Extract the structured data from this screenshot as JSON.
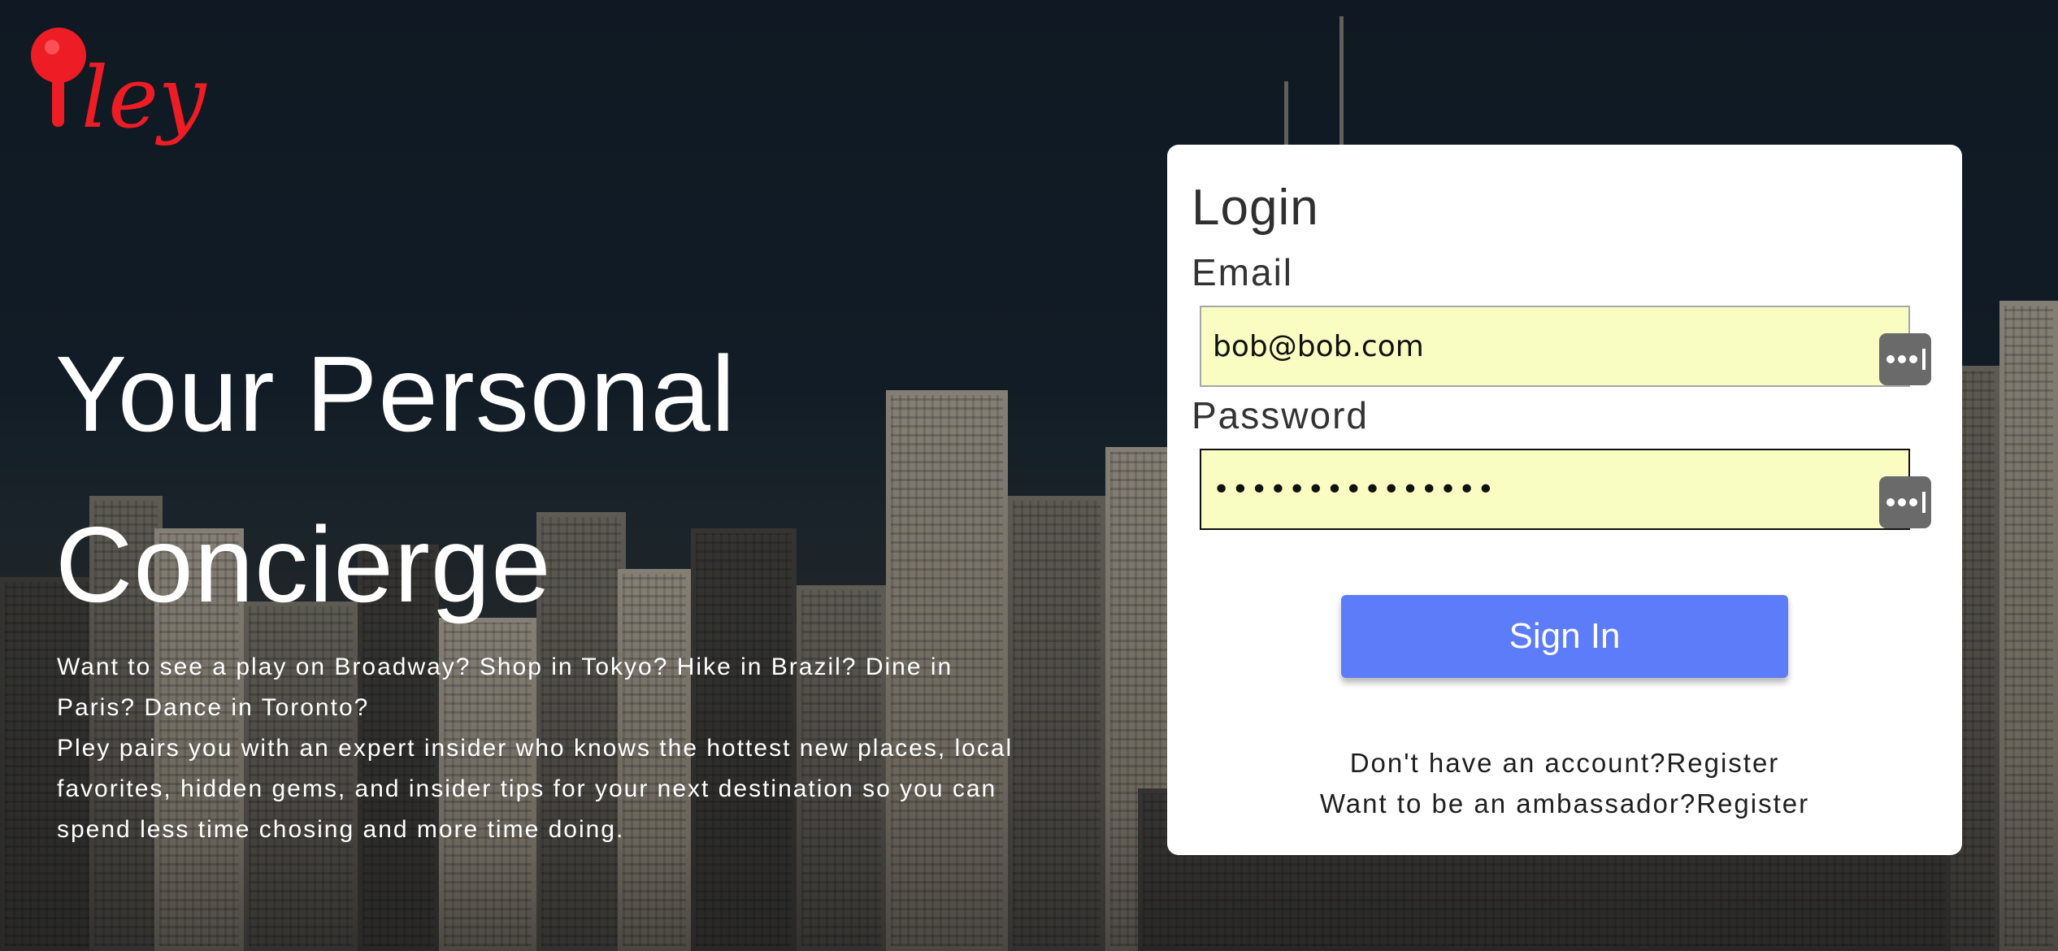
{
  "brand": {
    "logo_text": "ley",
    "logo_color": "#ee1c24"
  },
  "hero": {
    "title_line1": "Your Personal",
    "title_line2": "Concierge",
    "paragraph1": "Want to see a play on Broadway? Shop in Tokyo? Hike in Brazil? Dine in Paris? Dance in Toronto?",
    "paragraph2": "Pley pairs you with an expert insider who knows the hottest new places, local favorites, hidden gems, and insider tips for your next destination so you can spend less time chosing and more time doing."
  },
  "login": {
    "title": "Login",
    "email_label": "Email",
    "email_value": "bob@bob.com",
    "password_label": "Password",
    "password_value": "•••••••••••••••",
    "sign_in_label": "Sign In",
    "sign_in_color": "#5d7cfa",
    "register_prompt": "Don't have an account?",
    "register_link": "Register",
    "ambassador_prompt": "Want to be an ambassador?",
    "ambassador_link": "Register"
  },
  "icons": {
    "password_manager": "password-manager-key-icon"
  }
}
